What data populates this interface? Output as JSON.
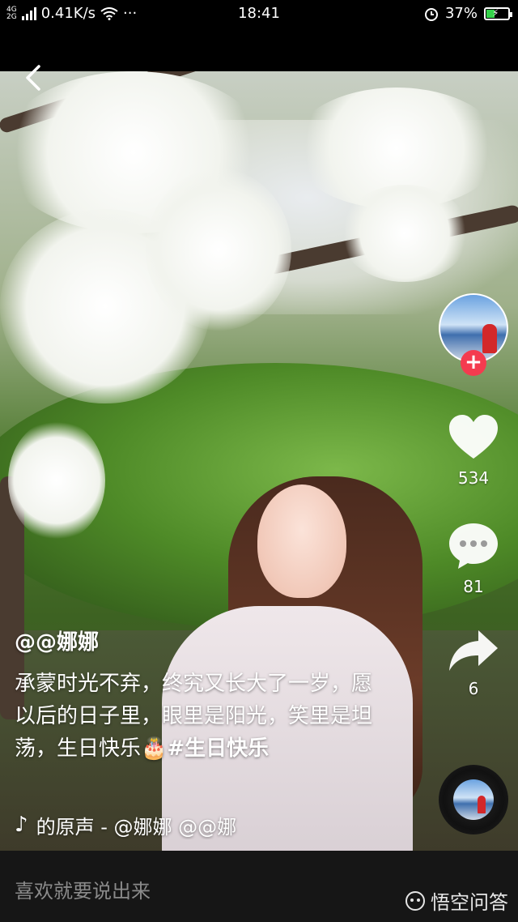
{
  "status_bar": {
    "network_top": "4G",
    "network_bottom": "2G",
    "speed": "0.41K/s",
    "more": "···",
    "time": "18:41",
    "battery_percent": "37%",
    "battery_level": 0.37
  },
  "video": {
    "author": "@@娜娜",
    "caption_text": "承蒙时光不弃，终究又长大了一岁，愿以后的日子里，眼里是阳光，笑里是坦荡，生日快乐🎂",
    "hashtag": "#生日快乐",
    "music": "的原声 - @娜娜    @@娜"
  },
  "actions": {
    "likes": "534",
    "comments": "81",
    "shares": "6"
  },
  "follow_label": "+",
  "comment_placeholder": "喜欢就要说出来",
  "watermark": "悟空问答",
  "icons": {
    "back": "back-arrow-icon",
    "like": "heart-icon",
    "comment": "comment-bubble-icon",
    "share": "share-arrow-icon",
    "music": "music-note-icon",
    "wifi": "wifi-icon",
    "alarm": "alarm-icon",
    "battery": "battery-icon"
  },
  "colors": {
    "follow": "#f43b4f",
    "battery": "#35d34a",
    "background": "#000000"
  }
}
